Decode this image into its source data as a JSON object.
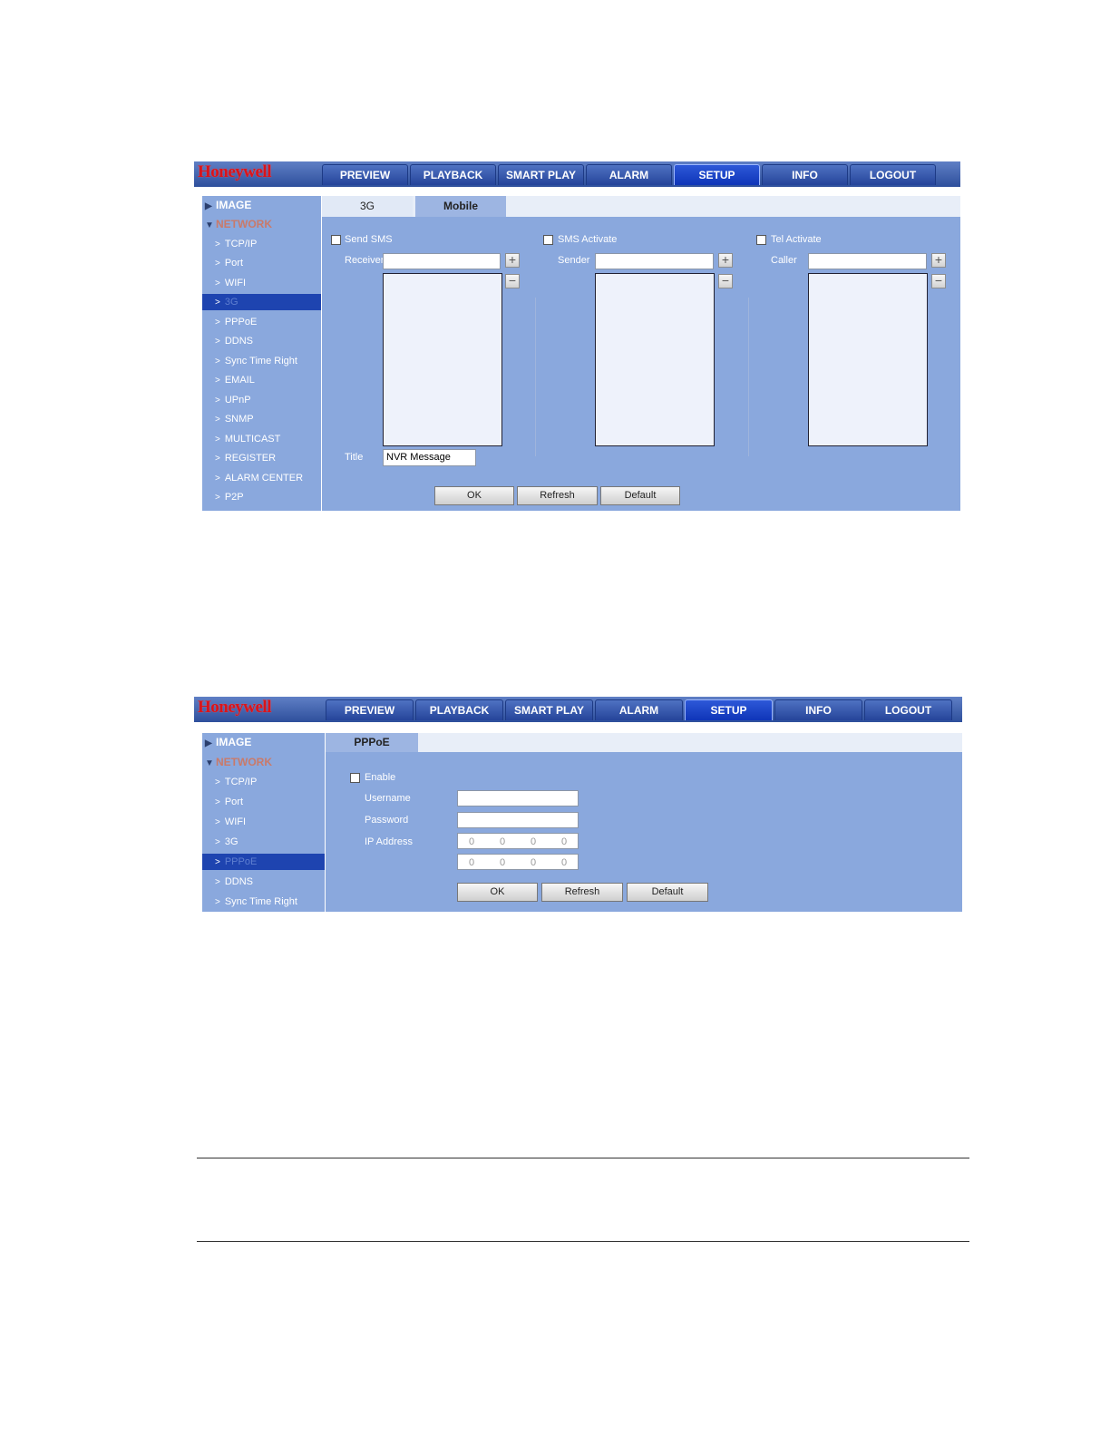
{
  "brand": "Honeywell",
  "nav": [
    "PREVIEW",
    "PLAYBACK",
    "SMART PLAY",
    "ALARM",
    "SETUP",
    "INFO",
    "LOGOUT"
  ],
  "nav_active": "SETUP",
  "colors": {
    "accent": "#1e44b0",
    "panel": "#8aa8dd",
    "brand": "#d8141b"
  },
  "shot1": {
    "sidebar": {
      "cat_image": "IMAGE",
      "cat_network": "NETWORK",
      "items": [
        "TCP/IP",
        "Port",
        "WIFI",
        "3G",
        "PPPoE",
        "DDNS",
        "Sync Time Right",
        "EMAIL",
        "UPnP",
        "SNMP",
        "MULTICAST",
        "REGISTER",
        "ALARM CENTER",
        "P2P"
      ],
      "active": "3G"
    },
    "tabs": [
      "3G",
      "Mobile"
    ],
    "active_tab": "Mobile",
    "col1": {
      "check": "Send SMS",
      "field": "Receiver"
    },
    "col2": {
      "check": "SMS Activate",
      "field": "Sender"
    },
    "col3": {
      "check": "Tel Activate",
      "field": "Caller"
    },
    "title_label": "Title",
    "title_value": "NVR Message",
    "buttons": [
      "OK",
      "Refresh",
      "Default"
    ]
  },
  "shot2": {
    "sidebar": {
      "cat_image": "IMAGE",
      "cat_network": "NETWORK",
      "items": [
        "TCP/IP",
        "Port",
        "WIFI",
        "3G",
        "PPPoE",
        "DDNS",
        "Sync Time Right"
      ],
      "active": "PPPoE"
    },
    "tab": "PPPoE",
    "enable": "Enable",
    "username": "Username",
    "password": "Password",
    "ip_address": "IP Address",
    "ip1": [
      "0",
      "0",
      "0",
      "0"
    ],
    "ip2": [
      "0",
      "0",
      "0",
      "0"
    ],
    "buttons": [
      "OK",
      "Refresh",
      "Default"
    ]
  }
}
